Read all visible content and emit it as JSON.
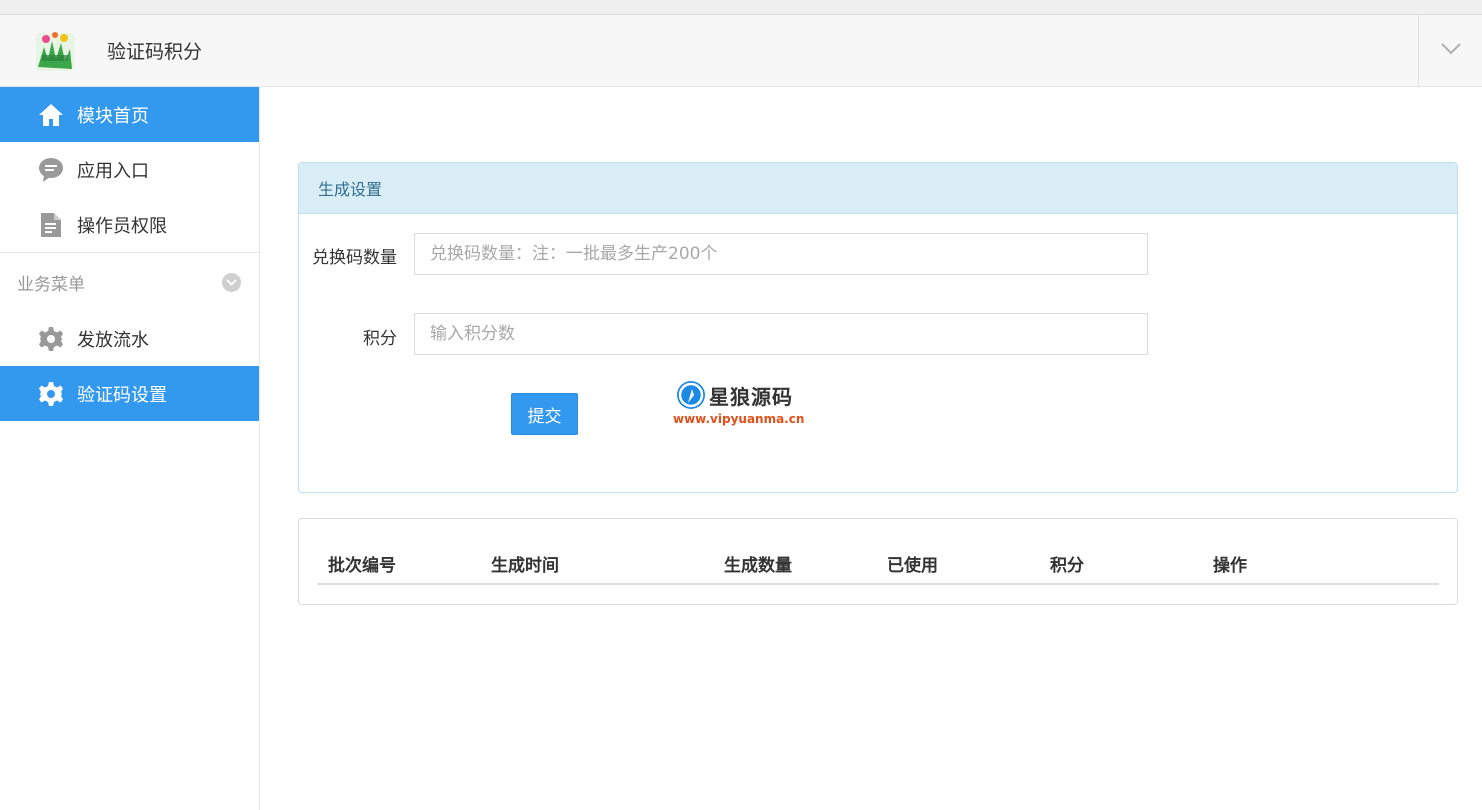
{
  "header": {
    "app_title": "验证码积分",
    "logo_icon": "app-logo-image",
    "toggle_icon": "chevron-down-icon"
  },
  "sidebar": {
    "items": [
      {
        "label": "模块首页",
        "icon": "home-icon",
        "active": true
      },
      {
        "label": "应用入口",
        "icon": "chat-icon",
        "active": false
      },
      {
        "label": "操作员权限",
        "icon": "document-icon",
        "active": false
      }
    ],
    "section": {
      "label": "业务菜单",
      "icon": "chevron-circle-icon"
    },
    "section_items": [
      {
        "label": "发放流水",
        "icon": "gear-icon",
        "active": false
      },
      {
        "label": "验证码设置",
        "icon": "gear-icon",
        "active": true
      }
    ]
  },
  "panel": {
    "title": "生成设置",
    "fields": [
      {
        "label": "兑换码数量",
        "placeholder": "兑换码数量：注：一批最多生产200个",
        "value": ""
      },
      {
        "label": "积分",
        "placeholder": "输入积分数",
        "value": ""
      }
    ],
    "submit_label": "提交"
  },
  "watermark": {
    "title": "星狼源码",
    "url": "www.vipyuanma.cn"
  },
  "table": {
    "columns": [
      "批次编号",
      "生成时间",
      "生成数量",
      "已使用",
      "积分",
      "操作"
    ],
    "rows": []
  },
  "colors": {
    "accent": "#3399ee",
    "panel_head_bg": "#d9edf7",
    "panel_head_text": "#31708f"
  }
}
